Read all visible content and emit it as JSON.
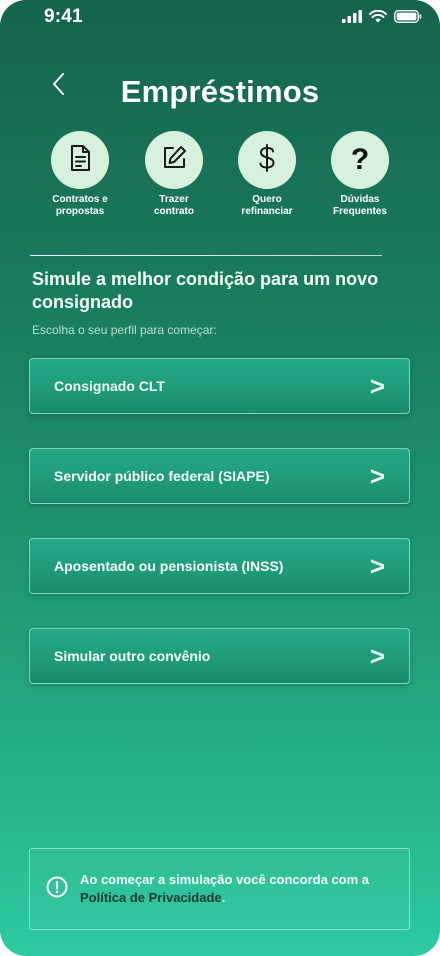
{
  "status_bar": {
    "time": "9:41",
    "icons": [
      "signal-icon",
      "wifi-icon",
      "battery-icon"
    ]
  },
  "header": {
    "back_icon": "chevron-left-icon",
    "title": "Empréstimos"
  },
  "quick_actions": [
    {
      "icon": "document-icon",
      "label": "Contratos e\npropostas"
    },
    {
      "icon": "edit-icon",
      "label": "Trazer\ncontrato"
    },
    {
      "icon": "dollar-icon",
      "label": "Quero\nrefinanciar"
    },
    {
      "icon": "question-icon",
      "glyph": "?",
      "label": "Dúvidas\nFrequentes"
    }
  ],
  "simulation": {
    "title": "Simule a melhor condição para um novo consignado",
    "subtitle": "Escolha o seu perfil para começar:",
    "chevron": ">",
    "options": [
      {
        "label": "Consignado CLT"
      },
      {
        "label": "Servidor público federal (SIAPE)"
      },
      {
        "label": "Aposentado ou pensionista (INSS)"
      },
      {
        "label": "Simular outro convênio"
      }
    ]
  },
  "privacy_notice": {
    "icon": "info-circle-icon",
    "text": "Ao começar a simulação você concorda com a ",
    "link_text": "Política de Privacidade",
    "suffix": "."
  },
  "colors": {
    "gradient_top": "#15634f",
    "gradient_bottom": "#2ccaa1",
    "icon_circle_bg": "#d7f1dc",
    "link": "#0f3d2e"
  }
}
